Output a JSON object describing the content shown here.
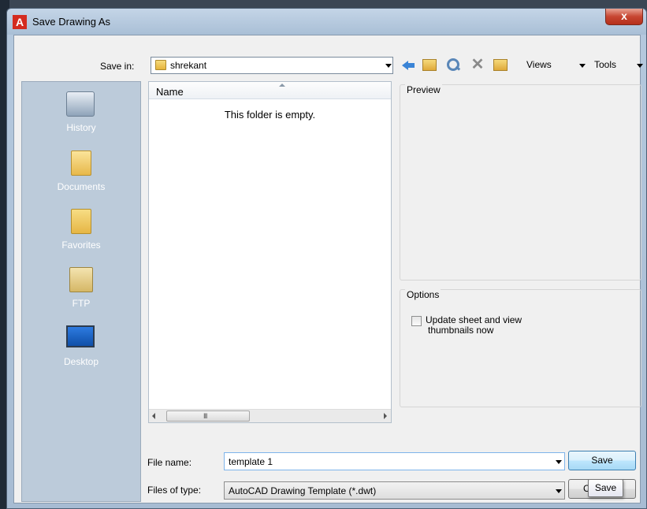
{
  "window": {
    "title": "Save Drawing As",
    "close_glyph": "x"
  },
  "save_in": {
    "label": "Save in:",
    "value": "shrekant"
  },
  "toolbar": {
    "icons": [
      "back-icon",
      "up-folder-icon",
      "search-web-icon",
      "delete-icon",
      "create-folder-icon"
    ],
    "delete_glyph": "✕",
    "views_label": "Views",
    "tools_label": "Tools"
  },
  "places": [
    {
      "label": "History",
      "icon": "history-icon"
    },
    {
      "label": "Documents",
      "icon": "documents-icon"
    },
    {
      "label": "Favorites",
      "icon": "favorites-icon"
    },
    {
      "label": "FTP",
      "icon": "ftp-icon"
    },
    {
      "label": "Desktop",
      "icon": "desktop-icon"
    }
  ],
  "file_list": {
    "column_name": "Name",
    "empty_message": "This folder is empty.",
    "scroll_grip": "III"
  },
  "preview": {
    "title": "Preview"
  },
  "options": {
    "title": "Options",
    "checkbox_label_line1": "Update sheet and view",
    "checkbox_label_line2": "thumbnails now",
    "checked": false
  },
  "file_name": {
    "label": "File name:",
    "value": "template 1"
  },
  "file_type": {
    "label": "Files of type:",
    "value": "AutoCAD Drawing Template (*.dwt)"
  },
  "buttons": {
    "save": "Save",
    "cancel_partial": "C"
  },
  "tooltip": {
    "text": "Save"
  }
}
